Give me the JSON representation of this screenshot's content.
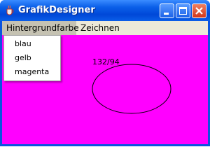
{
  "window": {
    "title": "GrafikDesigner",
    "app_icon": "java-cup-icon"
  },
  "titlebar_buttons": {
    "minimize": "minimize-icon",
    "maximize": "maximize-icon",
    "close": "close-icon"
  },
  "menubar": {
    "items": [
      "Hintergrundfarbe",
      "Zeichnen"
    ],
    "open_menu": "Hintergrundfarbe"
  },
  "dropdown": {
    "items": [
      "blau",
      "gelb",
      "magenta"
    ]
  },
  "canvas": {
    "background_color": "#ff00ff",
    "coordinate_label": "132/94",
    "shape": "ellipse"
  }
}
